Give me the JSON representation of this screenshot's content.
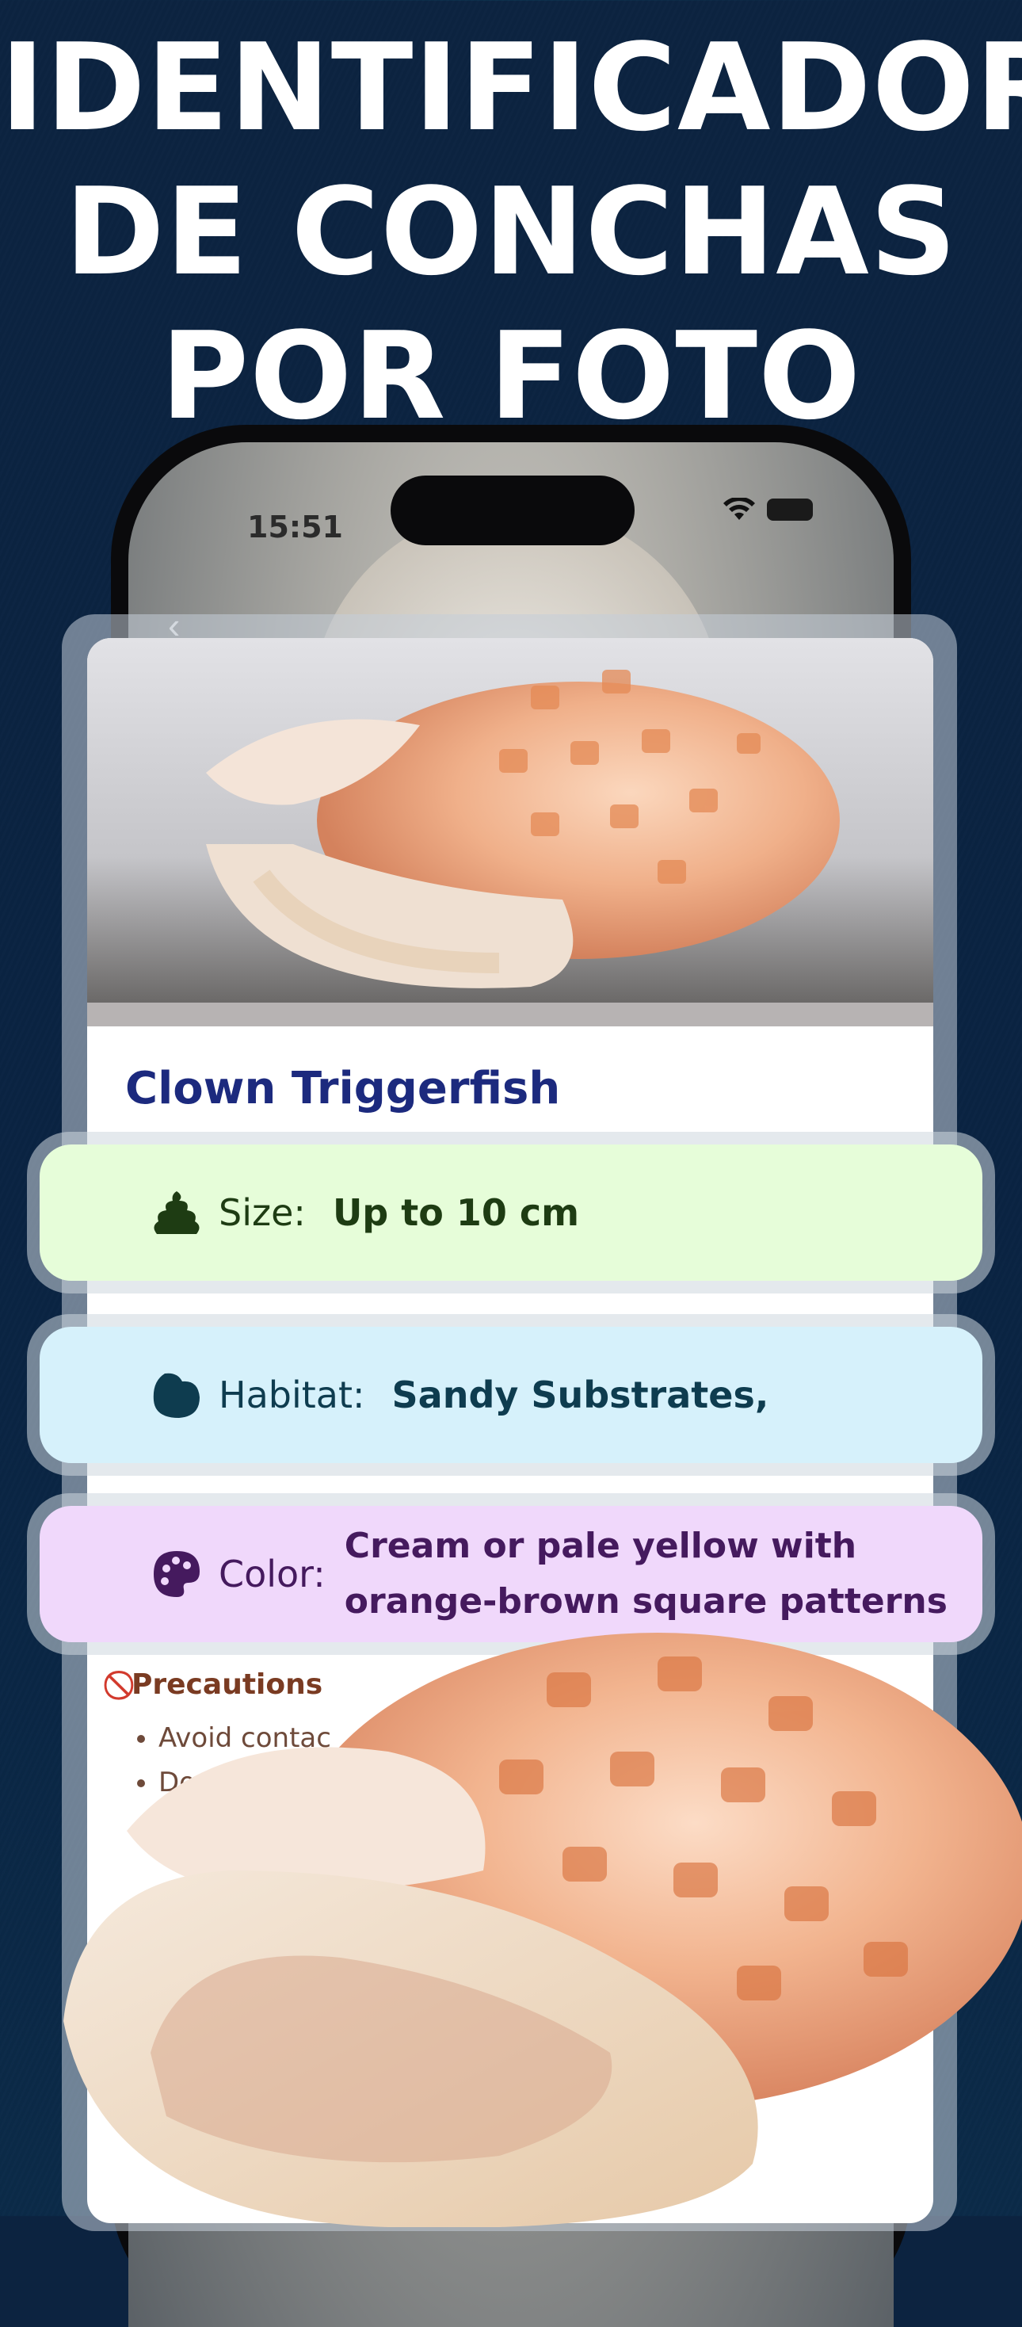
{
  "headline": {
    "line1": "IDENTIFICADOR",
    "line2": "DE CONCHAS",
    "line3": "POR FOTO"
  },
  "status_bar": {
    "time": "15:51"
  },
  "card": {
    "species_name": "Clown Triggerfish"
  },
  "info": {
    "size": {
      "icon": "poop-icon",
      "label": "Size:",
      "value": "Up to 10 cm",
      "bg": "#e6fdd9"
    },
    "habitat": {
      "icon": "blob-icon",
      "label": "Habitat:",
      "value": "Sandy Substrates,",
      "bg": "#d6f1fb"
    },
    "color": {
      "icon": "palette-icon",
      "label": "Color:",
      "value_line1": "Cream or pale yellow with",
      "value_line2": "orange-brown square patterns",
      "bg": "#f0d8fb"
    }
  },
  "precautions": {
    "title": "Precautions",
    "items": [
      "Avoid contac",
      "Do",
      ""
    ]
  }
}
